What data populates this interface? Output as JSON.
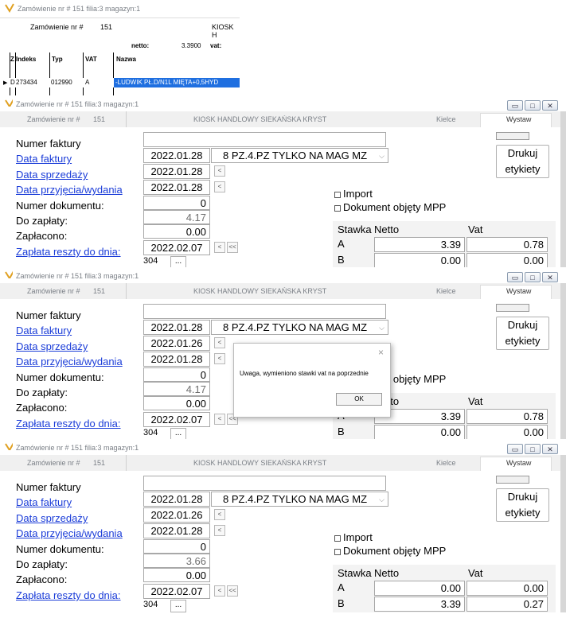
{
  "top": {
    "title": "Zamówienie nr #     151  filia:3 magazyn:1",
    "order_label": "Zamówienie nr #",
    "order_no": "151",
    "client_partial": "KIOSK H",
    "netto_label": "netto:",
    "netto_value": "3.3900",
    "vat_label": "vat:",
    "columns": [
      "Z",
      "Indeks",
      "Typ",
      "VAT",
      "Nazwa"
    ],
    "row": {
      "z": "D",
      "indeks": "273434",
      "typ": "012990",
      "vat": "A",
      "nazwa": "-LUDWIK PŁ.D/N1L MIĘTA+0,5HYD"
    }
  },
  "common": {
    "title": "Zamówienie nr #     151  filia:3 magazyn:1",
    "order_label": "Zamówienie nr #",
    "order_no": "151",
    "client": "KIOSK HANDLOWY SIEKAŃSKA KRYST",
    "city": "Kielce",
    "tab": "Wystaw",
    "numer_faktury": "Numer faktury",
    "data_faktury": "Data faktury",
    "data_sprzedazy": "Data sprzedaży",
    "data_przyjecia": "Data przyjęcia/wydania",
    "numer_dokumentu": "Numer dokumentu:",
    "do_zaplaty": "Do zapłaty:",
    "zaplacono": "Zapłacono:",
    "zaplata_reszty": "Zapłata reszty do dnia:",
    "drukuj": "Drukuj",
    "etykiety": "etykiety",
    "import": "Import",
    "mpp": "Dokument objęty MPP",
    "stawka": "Stawka",
    "netto": "Netto",
    "vat": "Vat",
    "doc_type": "8 PZ.4.PZ TYLKO NA MAG MZ",
    "btn_prev": "<",
    "btn_first": "<<",
    "mini_num": "304",
    "mini_btn": "..."
  },
  "panels": [
    {
      "data_faktury": "2022.01.28",
      "data_sprzedazy": "2022.01.28",
      "data_przyjecia": "2022.01.28",
      "numer_dokumentu": "0",
      "do_zaplaty": "4.17",
      "zaplacono": "0.00",
      "zaplata_reszty": "2022.02.07",
      "rates": [
        {
          "stawka": "A",
          "netto": "3.39",
          "vat": "0.78"
        },
        {
          "stawka": "B",
          "netto": "0.00",
          "vat": "0.00"
        }
      ]
    },
    {
      "data_faktury": "2022.01.28",
      "data_sprzedazy": "2022.01.26",
      "data_przyjecia": "2022.01.28",
      "numer_dokumentu": "0",
      "do_zaplaty": "4.17",
      "zaplacono": "0.00",
      "zaplata_reszty": "2022.02.07",
      "rates": [
        {
          "stawka": "A",
          "netto": "3.39",
          "vat": "0.78"
        },
        {
          "stawka": "B",
          "netto": "0.00",
          "vat": "0.00"
        }
      ],
      "dialog": {
        "message": "Uwaga, wymieniono stawki vat na poprzednie",
        "ok": "OK",
        "close": "×"
      }
    },
    {
      "data_faktury": "2022.01.28",
      "data_sprzedazy": "2022.01.26",
      "data_przyjecia": "2022.01.28",
      "numer_dokumentu": "0",
      "do_zaplaty": "3.66",
      "zaplacono": "0.00",
      "zaplata_reszty": "2022.02.07",
      "rates": [
        {
          "stawka": "A",
          "netto": "0.00",
          "vat": "0.00"
        },
        {
          "stawka": "B",
          "netto": "3.39",
          "vat": "0.27"
        }
      ]
    }
  ]
}
